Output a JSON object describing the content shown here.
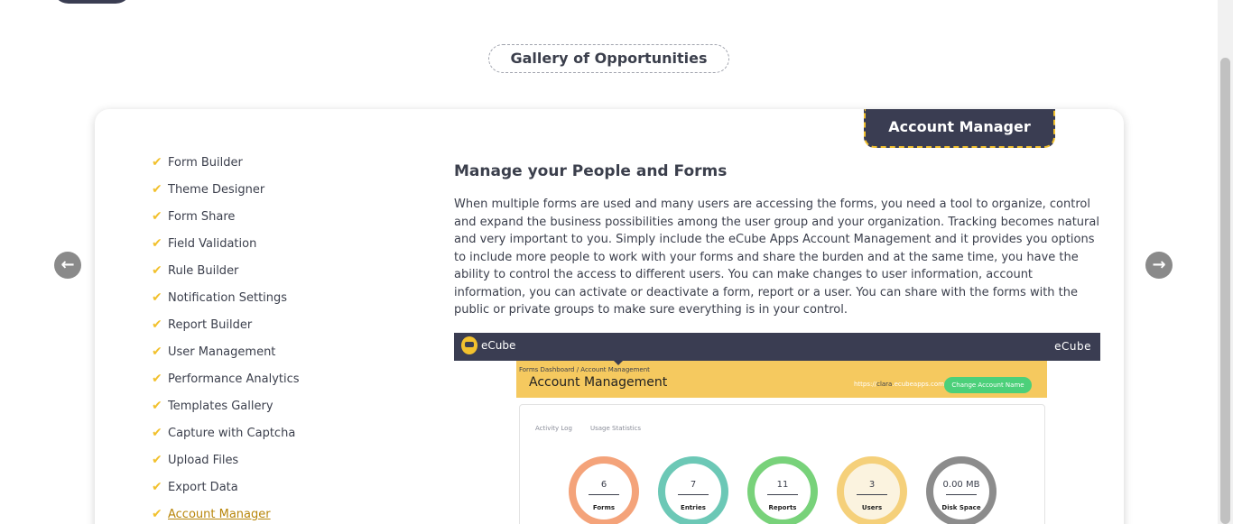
{
  "gallery": {
    "title": "Gallery of Opportunities"
  },
  "tab": {
    "label": "Account Manager"
  },
  "features": [
    {
      "label": "Form Builder"
    },
    {
      "label": "Theme Designer"
    },
    {
      "label": "Form Share"
    },
    {
      "label": "Field Validation"
    },
    {
      "label": "Rule Builder"
    },
    {
      "label": "Notification Settings"
    },
    {
      "label": "Report Builder"
    },
    {
      "label": "User Management"
    },
    {
      "label": "Performance Analytics"
    },
    {
      "label": "Templates Gallery"
    },
    {
      "label": "Capture with Captcha"
    },
    {
      "label": "Upload Files"
    },
    {
      "label": "Export Data"
    },
    {
      "label": "Account Manager"
    }
  ],
  "content": {
    "heading": "Manage your People and Forms",
    "body": "When multiple forms are used and many users are accessing the forms, you need a tool to organize, control and expand the business possibilities among the user group and your organization. Tracking becomes natural and very important to you. Simply include the eCube Apps Account Management and it provides you options to include more people to work with your forms and share the burden and at the same time, you have the ability to control the access to different users. You can make changes to user information, account information, you can activate or deactivate a form, report or a user. You can share with the forms with the public or private groups to make sure everything is in your control."
  },
  "nav": {
    "prev_glyph": "←",
    "next_glyph": "→"
  },
  "screenshot": {
    "logo_text": "eCube",
    "brand_right": "eCube",
    "breadcrumb": "Forms Dashboard / Account Management",
    "page_title": "Account Management",
    "url_prefix": "https://",
    "url_highlight": "clara",
    "url_suffix": ".ecubeapps.com",
    "change_button": "Change Account Name",
    "tabs": {
      "activity": "Activity Log",
      "usage": "Usage Statistics"
    },
    "stats": [
      {
        "value": "6",
        "label": "Forms"
      },
      {
        "value": "7",
        "label": "Entries"
      },
      {
        "value": "11",
        "label": "Reports"
      },
      {
        "value": "3",
        "label": "Users"
      },
      {
        "value": "0.00 MB",
        "label": "Disk Space"
      }
    ]
  },
  "colors": {
    "accent": "#f2c12e",
    "dark": "#3a3d52",
    "text": "#3b3f4c"
  }
}
